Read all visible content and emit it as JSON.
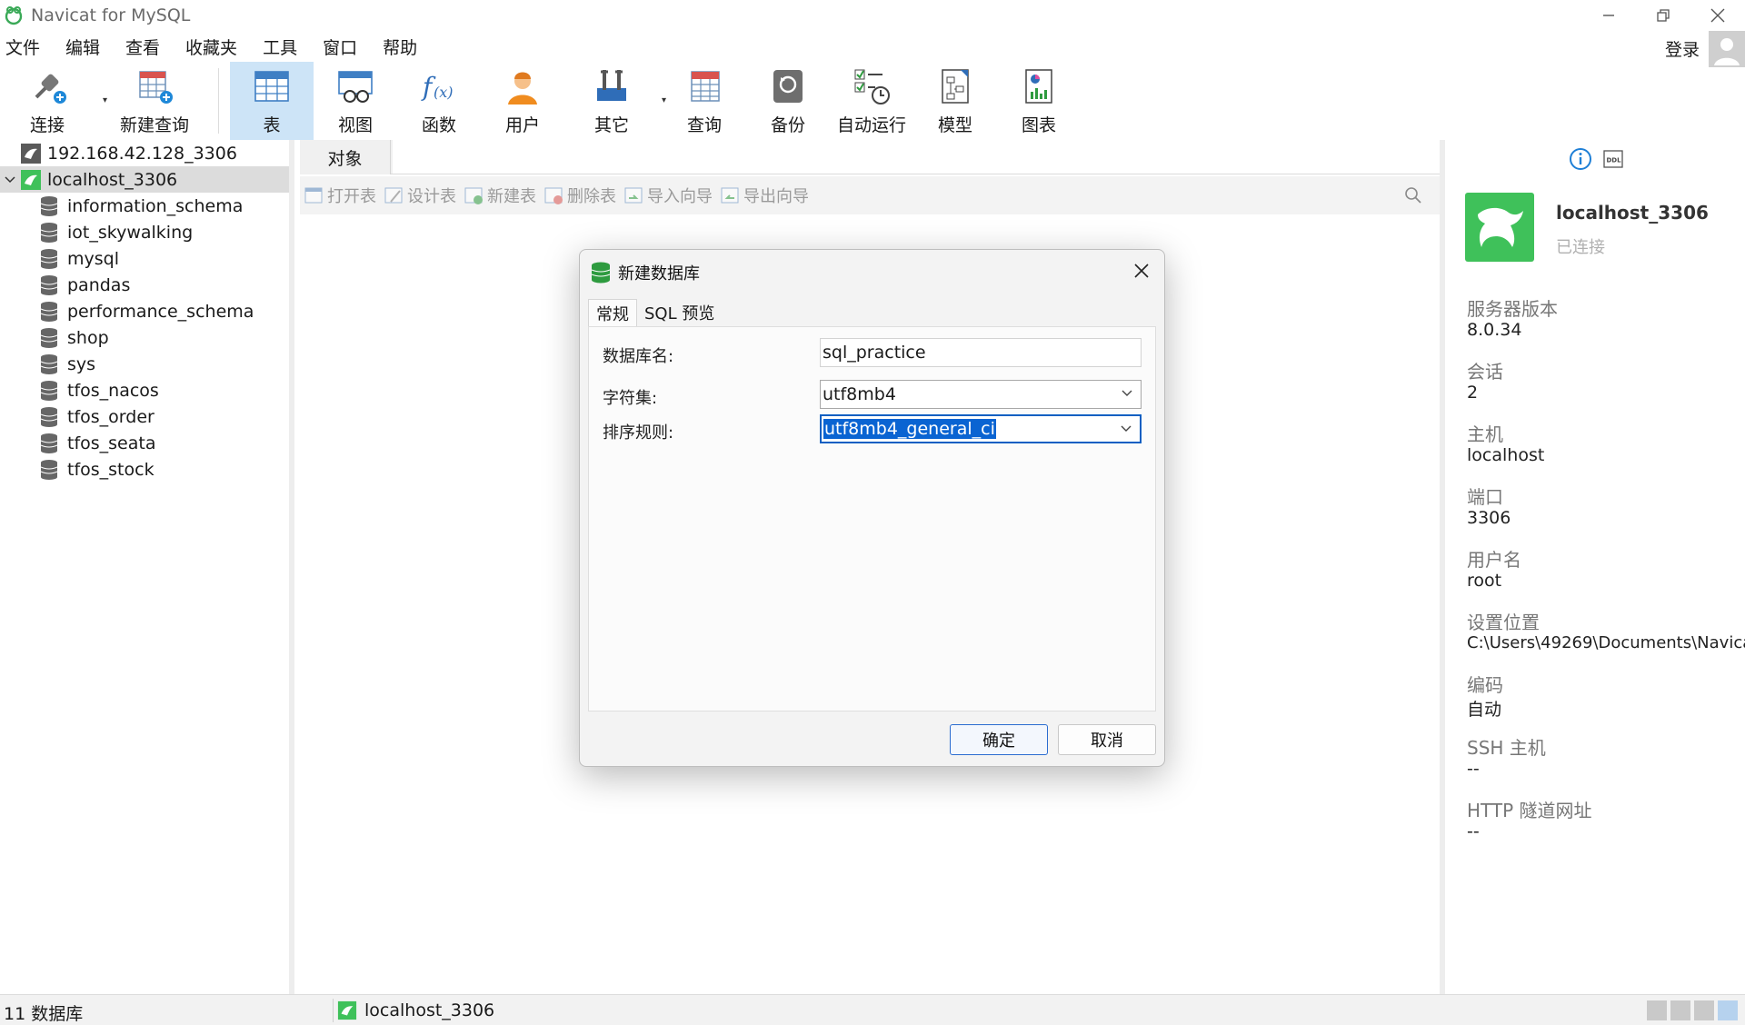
{
  "window": {
    "title": "Navicat for MySQL"
  },
  "menu": [
    "文件",
    "编辑",
    "查看",
    "收藏夹",
    "工具",
    "窗口",
    "帮助"
  ],
  "account": {
    "login_label": "登录"
  },
  "toolbar": {
    "connect": "连接",
    "new_query": "新建查询",
    "table": "表",
    "view": "视图",
    "function": "函数",
    "user": "用户",
    "other": "其它",
    "query": "查询",
    "backup": "备份",
    "automation": "自动运行",
    "model": "模型",
    "chart": "图表"
  },
  "tree": {
    "connections": [
      {
        "name": "192.168.42.128_3306"
      },
      {
        "name": "localhost_3306"
      }
    ],
    "databases": [
      "information_schema",
      "iot_skywalking",
      "mysql",
      "pandas",
      "performance_schema",
      "shop",
      "sys",
      "tfos_nacos",
      "tfos_order",
      "tfos_seata",
      "tfos_stock"
    ]
  },
  "objects": {
    "tab_label": "对象",
    "actions": [
      "打开表",
      "设计表",
      "新建表",
      "删除表",
      "导入向导",
      "导出向导"
    ]
  },
  "info": {
    "name": "localhost_3306",
    "status": "已连接",
    "fields": [
      {
        "label": "服务器版本",
        "value": "8.0.34"
      },
      {
        "label": "会话",
        "value": "2"
      },
      {
        "label": "主机",
        "value": "localhost"
      },
      {
        "label": "端口",
        "value": "3306"
      },
      {
        "label": "用户名",
        "value": "root"
      },
      {
        "label": "设置位置",
        "value": "C:\\Users\\49269\\Documents\\Navica"
      },
      {
        "label": "编码",
        "value": "自动"
      },
      {
        "label": "SSH 主机",
        "value": "--"
      },
      {
        "label": "HTTP 隧道网址",
        "value": "--"
      }
    ]
  },
  "dialog": {
    "title": "新建数据库",
    "tabs": [
      "常规",
      "SQL 预览"
    ],
    "db_name_label": "数据库名:",
    "db_name_value": "sql_practice",
    "charset_label": "字符集:",
    "charset_value": "utf8mb4",
    "collation_label": "排序规则:",
    "collation_value": "utf8mb4_general_ci",
    "ok": "确定",
    "cancel": "取消"
  },
  "status": {
    "db_count": "11 数据库",
    "connection": "localhost_3306"
  },
  "colors": {
    "accent": "#0a64d2",
    "dolphin_green": "#3fc15a",
    "active_tool": "#cde4f7"
  }
}
